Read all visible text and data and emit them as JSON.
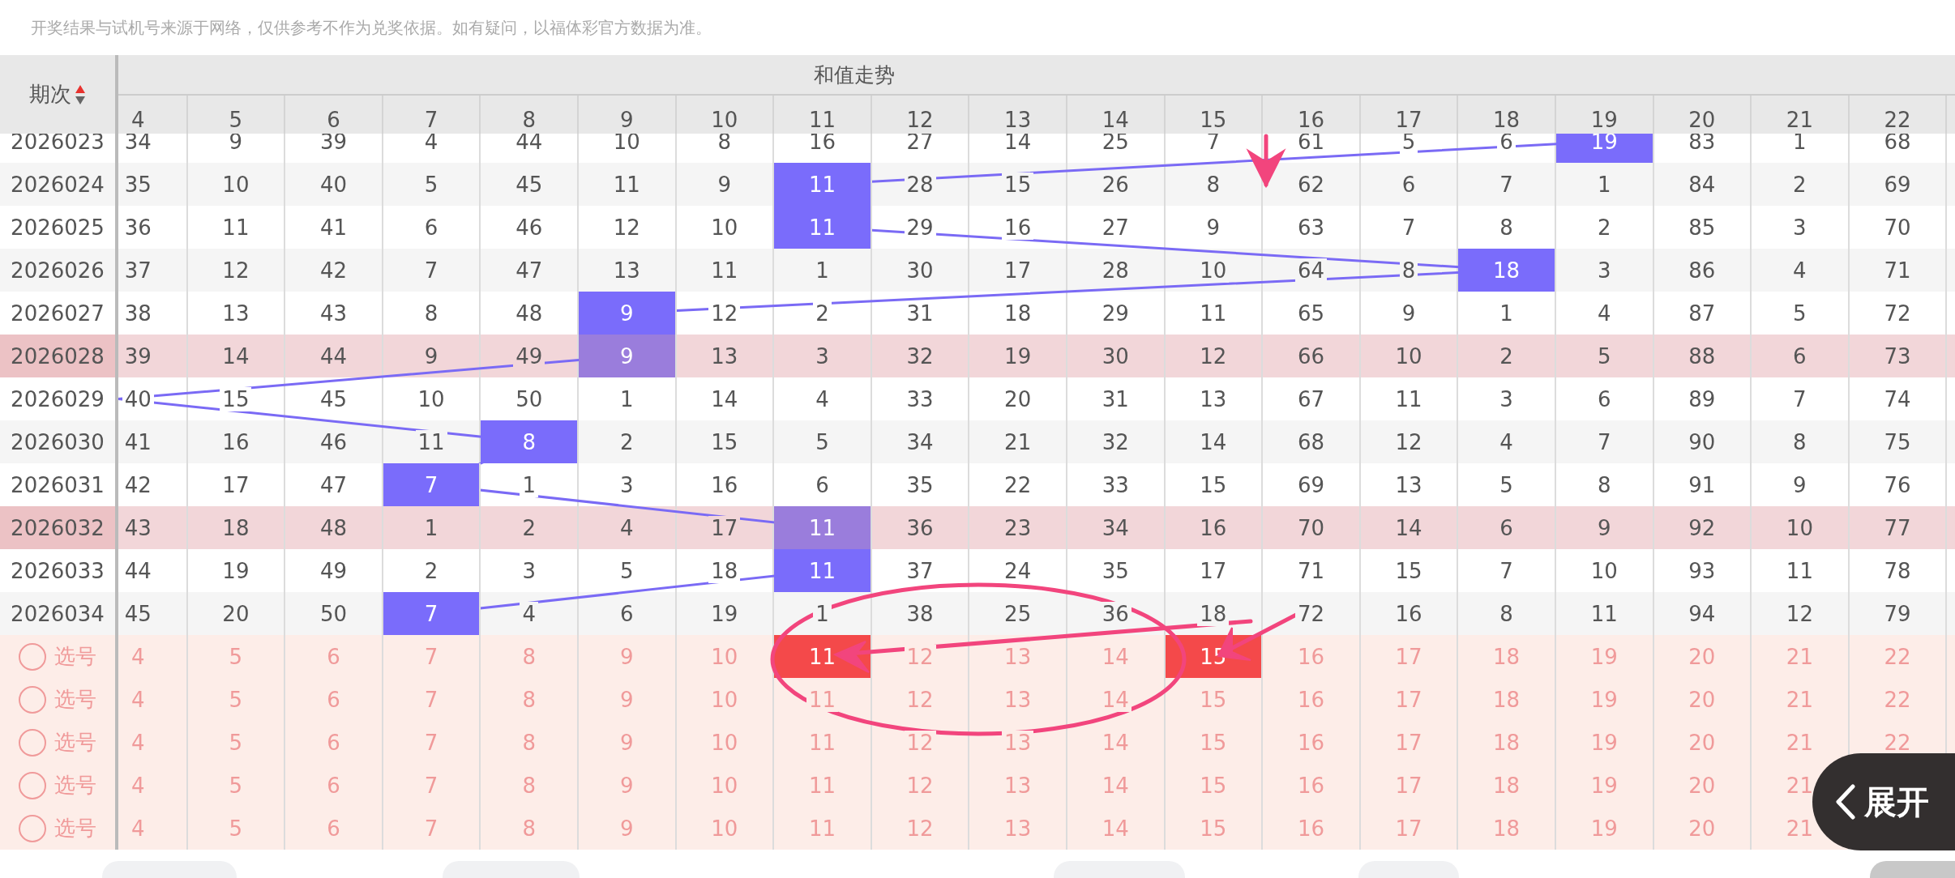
{
  "notice": "开奖结果与试机号来源于网络，仅供参考不作为兑奖依据。如有疑问，以福体彩官方数据为准。",
  "header": {
    "period_label": "期次",
    "title": "和值走势"
  },
  "columns": [
    "4",
    "5",
    "6",
    "7",
    "8",
    "9",
    "10",
    "11",
    "12",
    "13",
    "14",
    "15",
    "16",
    "17",
    "18",
    "19",
    "20",
    "21",
    "22"
  ],
  "rows": [
    {
      "period": "2026023",
      "highlighted": false,
      "cells": [
        {
          "text": "34",
          "hit": false
        },
        {
          "text": "9",
          "hit": false
        },
        {
          "text": "39",
          "hit": false
        },
        {
          "text": "4",
          "hit": false
        },
        {
          "text": "44",
          "hit": false
        },
        {
          "text": "10",
          "hit": false
        },
        {
          "text": "8",
          "hit": false
        },
        {
          "text": "16",
          "hit": false
        },
        {
          "text": "27",
          "hit": false
        },
        {
          "text": "14",
          "hit": false
        },
        {
          "text": "25",
          "hit": false
        },
        {
          "text": "7",
          "hit": false
        },
        {
          "text": "61",
          "hit": false
        },
        {
          "text": "5",
          "hit": false
        },
        {
          "text": "6",
          "hit": false
        },
        {
          "text": "19",
          "hit": true
        },
        {
          "text": "83",
          "hit": false
        },
        {
          "text": "1",
          "hit": false
        },
        {
          "text": "68",
          "hit": false
        }
      ]
    },
    {
      "period": "2026024",
      "highlighted": false,
      "cells": [
        {
          "text": "35",
          "hit": false
        },
        {
          "text": "10",
          "hit": false
        },
        {
          "text": "40",
          "hit": false
        },
        {
          "text": "5",
          "hit": false
        },
        {
          "text": "45",
          "hit": false
        },
        {
          "text": "11",
          "hit": false
        },
        {
          "text": "9",
          "hit": false
        },
        {
          "text": "11",
          "hit": true
        },
        {
          "text": "28",
          "hit": false
        },
        {
          "text": "15",
          "hit": false
        },
        {
          "text": "26",
          "hit": false
        },
        {
          "text": "8",
          "hit": false
        },
        {
          "text": "62",
          "hit": false
        },
        {
          "text": "6",
          "hit": false
        },
        {
          "text": "7",
          "hit": false
        },
        {
          "text": "1",
          "hit": false
        },
        {
          "text": "84",
          "hit": false
        },
        {
          "text": "2",
          "hit": false
        },
        {
          "text": "69",
          "hit": false
        }
      ]
    },
    {
      "period": "2026025",
      "highlighted": false,
      "cells": [
        {
          "text": "36",
          "hit": false
        },
        {
          "text": "11",
          "hit": false
        },
        {
          "text": "41",
          "hit": false
        },
        {
          "text": "6",
          "hit": false
        },
        {
          "text": "46",
          "hit": false
        },
        {
          "text": "12",
          "hit": false
        },
        {
          "text": "10",
          "hit": false
        },
        {
          "text": "11",
          "hit": true
        },
        {
          "text": "29",
          "hit": false
        },
        {
          "text": "16",
          "hit": false
        },
        {
          "text": "27",
          "hit": false
        },
        {
          "text": "9",
          "hit": false
        },
        {
          "text": "63",
          "hit": false
        },
        {
          "text": "7",
          "hit": false
        },
        {
          "text": "8",
          "hit": false
        },
        {
          "text": "2",
          "hit": false
        },
        {
          "text": "85",
          "hit": false
        },
        {
          "text": "3",
          "hit": false
        },
        {
          "text": "70",
          "hit": false
        }
      ]
    },
    {
      "period": "2026026",
      "highlighted": false,
      "cells": [
        {
          "text": "37",
          "hit": false
        },
        {
          "text": "12",
          "hit": false
        },
        {
          "text": "42",
          "hit": false
        },
        {
          "text": "7",
          "hit": false
        },
        {
          "text": "47",
          "hit": false
        },
        {
          "text": "13",
          "hit": false
        },
        {
          "text": "11",
          "hit": false
        },
        {
          "text": "1",
          "hit": false
        },
        {
          "text": "30",
          "hit": false
        },
        {
          "text": "17",
          "hit": false
        },
        {
          "text": "28",
          "hit": false
        },
        {
          "text": "10",
          "hit": false
        },
        {
          "text": "64",
          "hit": false
        },
        {
          "text": "8",
          "hit": false
        },
        {
          "text": "18",
          "hit": true
        },
        {
          "text": "3",
          "hit": false
        },
        {
          "text": "86",
          "hit": false
        },
        {
          "text": "4",
          "hit": false
        },
        {
          "text": "71",
          "hit": false
        }
      ]
    },
    {
      "period": "2026027",
      "highlighted": false,
      "cells": [
        {
          "text": "38",
          "hit": false
        },
        {
          "text": "13",
          "hit": false
        },
        {
          "text": "43",
          "hit": false
        },
        {
          "text": "8",
          "hit": false
        },
        {
          "text": "48",
          "hit": false
        },
        {
          "text": "9",
          "hit": true
        },
        {
          "text": "12",
          "hit": false
        },
        {
          "text": "2",
          "hit": false
        },
        {
          "text": "31",
          "hit": false
        },
        {
          "text": "18",
          "hit": false
        },
        {
          "text": "29",
          "hit": false
        },
        {
          "text": "11",
          "hit": false
        },
        {
          "text": "65",
          "hit": false
        },
        {
          "text": "9",
          "hit": false
        },
        {
          "text": "1",
          "hit": false
        },
        {
          "text": "4",
          "hit": false
        },
        {
          "text": "87",
          "hit": false
        },
        {
          "text": "5",
          "hit": false
        },
        {
          "text": "72",
          "hit": false
        }
      ]
    },
    {
      "period": "2026028",
      "highlighted": true,
      "cells": [
        {
          "text": "39",
          "hit": false
        },
        {
          "text": "14",
          "hit": false
        },
        {
          "text": "44",
          "hit": false
        },
        {
          "text": "9",
          "hit": false
        },
        {
          "text": "49",
          "hit": false
        },
        {
          "text": "9",
          "hit": true
        },
        {
          "text": "13",
          "hit": false
        },
        {
          "text": "3",
          "hit": false
        },
        {
          "text": "32",
          "hit": false
        },
        {
          "text": "19",
          "hit": false
        },
        {
          "text": "30",
          "hit": false
        },
        {
          "text": "12",
          "hit": false
        },
        {
          "text": "66",
          "hit": false
        },
        {
          "text": "10",
          "hit": false
        },
        {
          "text": "2",
          "hit": false
        },
        {
          "text": "5",
          "hit": false
        },
        {
          "text": "88",
          "hit": false
        },
        {
          "text": "6",
          "hit": false
        },
        {
          "text": "73",
          "hit": false
        }
      ]
    },
    {
      "period": "2026029",
      "highlighted": false,
      "cells": [
        {
          "text": "40",
          "hit": false
        },
        {
          "text": "15",
          "hit": false
        },
        {
          "text": "45",
          "hit": false
        },
        {
          "text": "10",
          "hit": false
        },
        {
          "text": "50",
          "hit": false
        },
        {
          "text": "1",
          "hit": false
        },
        {
          "text": "14",
          "hit": false
        },
        {
          "text": "4",
          "hit": false
        },
        {
          "text": "33",
          "hit": false
        },
        {
          "text": "20",
          "hit": false
        },
        {
          "text": "31",
          "hit": false
        },
        {
          "text": "13",
          "hit": false
        },
        {
          "text": "67",
          "hit": false
        },
        {
          "text": "11",
          "hit": false
        },
        {
          "text": "3",
          "hit": false
        },
        {
          "text": "6",
          "hit": false
        },
        {
          "text": "89",
          "hit": false
        },
        {
          "text": "7",
          "hit": false
        },
        {
          "text": "74",
          "hit": false
        }
      ]
    },
    {
      "period": "2026030",
      "highlighted": false,
      "cells": [
        {
          "text": "41",
          "hit": false
        },
        {
          "text": "16",
          "hit": false
        },
        {
          "text": "46",
          "hit": false
        },
        {
          "text": "11",
          "hit": false
        },
        {
          "text": "8",
          "hit": true
        },
        {
          "text": "2",
          "hit": false
        },
        {
          "text": "15",
          "hit": false
        },
        {
          "text": "5",
          "hit": false
        },
        {
          "text": "34",
          "hit": false
        },
        {
          "text": "21",
          "hit": false
        },
        {
          "text": "32",
          "hit": false
        },
        {
          "text": "14",
          "hit": false
        },
        {
          "text": "68",
          "hit": false
        },
        {
          "text": "12",
          "hit": false
        },
        {
          "text": "4",
          "hit": false
        },
        {
          "text": "7",
          "hit": false
        },
        {
          "text": "90",
          "hit": false
        },
        {
          "text": "8",
          "hit": false
        },
        {
          "text": "75",
          "hit": false
        }
      ]
    },
    {
      "period": "2026031",
      "highlighted": false,
      "cells": [
        {
          "text": "42",
          "hit": false
        },
        {
          "text": "17",
          "hit": false
        },
        {
          "text": "47",
          "hit": false
        },
        {
          "text": "7",
          "hit": true
        },
        {
          "text": "1",
          "hit": false
        },
        {
          "text": "3",
          "hit": false
        },
        {
          "text": "16",
          "hit": false
        },
        {
          "text": "6",
          "hit": false
        },
        {
          "text": "35",
          "hit": false
        },
        {
          "text": "22",
          "hit": false
        },
        {
          "text": "33",
          "hit": false
        },
        {
          "text": "15",
          "hit": false
        },
        {
          "text": "69",
          "hit": false
        },
        {
          "text": "13",
          "hit": false
        },
        {
          "text": "5",
          "hit": false
        },
        {
          "text": "8",
          "hit": false
        },
        {
          "text": "91",
          "hit": false
        },
        {
          "text": "9",
          "hit": false
        },
        {
          "text": "76",
          "hit": false
        }
      ]
    },
    {
      "period": "2026032",
      "highlighted": true,
      "cells": [
        {
          "text": "43",
          "hit": false
        },
        {
          "text": "18",
          "hit": false
        },
        {
          "text": "48",
          "hit": false
        },
        {
          "text": "1",
          "hit": false
        },
        {
          "text": "2",
          "hit": false
        },
        {
          "text": "4",
          "hit": false
        },
        {
          "text": "17",
          "hit": false
        },
        {
          "text": "11",
          "hit": true
        },
        {
          "text": "36",
          "hit": false
        },
        {
          "text": "23",
          "hit": false
        },
        {
          "text": "34",
          "hit": false
        },
        {
          "text": "16",
          "hit": false
        },
        {
          "text": "70",
          "hit": false
        },
        {
          "text": "14",
          "hit": false
        },
        {
          "text": "6",
          "hit": false
        },
        {
          "text": "9",
          "hit": false
        },
        {
          "text": "92",
          "hit": false
        },
        {
          "text": "10",
          "hit": false
        },
        {
          "text": "77",
          "hit": false
        }
      ]
    },
    {
      "period": "2026033",
      "highlighted": false,
      "cells": [
        {
          "text": "44",
          "hit": false
        },
        {
          "text": "19",
          "hit": false
        },
        {
          "text": "49",
          "hit": false
        },
        {
          "text": "2",
          "hit": false
        },
        {
          "text": "3",
          "hit": false
        },
        {
          "text": "5",
          "hit": false
        },
        {
          "text": "18",
          "hit": false
        },
        {
          "text": "11",
          "hit": true
        },
        {
          "text": "37",
          "hit": false
        },
        {
          "text": "24",
          "hit": false
        },
        {
          "text": "35",
          "hit": false
        },
        {
          "text": "17",
          "hit": false
        },
        {
          "text": "71",
          "hit": false
        },
        {
          "text": "15",
          "hit": false
        },
        {
          "text": "7",
          "hit": false
        },
        {
          "text": "10",
          "hit": false
        },
        {
          "text": "93",
          "hit": false
        },
        {
          "text": "11",
          "hit": false
        },
        {
          "text": "78",
          "hit": false
        }
      ]
    },
    {
      "period": "2026034",
      "highlighted": false,
      "cells": [
        {
          "text": "45",
          "hit": false
        },
        {
          "text": "20",
          "hit": false
        },
        {
          "text": "50",
          "hit": false
        },
        {
          "text": "7",
          "hit": true
        },
        {
          "text": "4",
          "hit": false
        },
        {
          "text": "6",
          "hit": false
        },
        {
          "text": "19",
          "hit": false
        },
        {
          "text": "1",
          "hit": false
        },
        {
          "text": "38",
          "hit": false
        },
        {
          "text": "25",
          "hit": false
        },
        {
          "text": "36",
          "hit": false
        },
        {
          "text": "18",
          "hit": false
        },
        {
          "text": "72",
          "hit": false
        },
        {
          "text": "16",
          "hit": false
        },
        {
          "text": "8",
          "hit": false
        },
        {
          "text": "11",
          "hit": false
        },
        {
          "text": "94",
          "hit": false
        },
        {
          "text": "12",
          "hit": false
        },
        {
          "text": "79",
          "hit": false
        }
      ]
    }
  ],
  "picks": [
    {
      "label": "选号",
      "cells": [
        {
          "text": "4",
          "selected": false
        },
        {
          "text": "5",
          "selected": false
        },
        {
          "text": "6",
          "selected": false
        },
        {
          "text": "7",
          "selected": false
        },
        {
          "text": "8",
          "selected": false
        },
        {
          "text": "9",
          "selected": false
        },
        {
          "text": "10",
          "selected": false
        },
        {
          "text": "11",
          "selected": true
        },
        {
          "text": "12",
          "selected": false
        },
        {
          "text": "13",
          "selected": false
        },
        {
          "text": "14",
          "selected": false
        },
        {
          "text": "15",
          "selected": true
        },
        {
          "text": "16",
          "selected": false
        },
        {
          "text": "17",
          "selected": false
        },
        {
          "text": "18",
          "selected": false
        },
        {
          "text": "19",
          "selected": false
        },
        {
          "text": "20",
          "selected": false
        },
        {
          "text": "21",
          "selected": false
        },
        {
          "text": "22",
          "selected": false
        }
      ]
    },
    {
      "label": "选号",
      "cells": [
        {
          "text": "4",
          "selected": false
        },
        {
          "text": "5",
          "selected": false
        },
        {
          "text": "6",
          "selected": false
        },
        {
          "text": "7",
          "selected": false
        },
        {
          "text": "8",
          "selected": false
        },
        {
          "text": "9",
          "selected": false
        },
        {
          "text": "10",
          "selected": false
        },
        {
          "text": "11",
          "selected": false
        },
        {
          "text": "12",
          "selected": false
        },
        {
          "text": "13",
          "selected": false
        },
        {
          "text": "14",
          "selected": false
        },
        {
          "text": "15",
          "selected": false
        },
        {
          "text": "16",
          "selected": false
        },
        {
          "text": "17",
          "selected": false
        },
        {
          "text": "18",
          "selected": false
        },
        {
          "text": "19",
          "selected": false
        },
        {
          "text": "20",
          "selected": false
        },
        {
          "text": "21",
          "selected": false
        },
        {
          "text": "22",
          "selected": false
        }
      ]
    },
    {
      "label": "选号",
      "cells": [
        {
          "text": "4",
          "selected": false
        },
        {
          "text": "5",
          "selected": false
        },
        {
          "text": "6",
          "selected": false
        },
        {
          "text": "7",
          "selected": false
        },
        {
          "text": "8",
          "selected": false
        },
        {
          "text": "9",
          "selected": false
        },
        {
          "text": "10",
          "selected": false
        },
        {
          "text": "11",
          "selected": false
        },
        {
          "text": "12",
          "selected": false
        },
        {
          "text": "13",
          "selected": false
        },
        {
          "text": "14",
          "selected": false
        },
        {
          "text": "15",
          "selected": false
        },
        {
          "text": "16",
          "selected": false
        },
        {
          "text": "17",
          "selected": false
        },
        {
          "text": "18",
          "selected": false
        },
        {
          "text": "19",
          "selected": false
        },
        {
          "text": "20",
          "selected": false
        },
        {
          "text": "21",
          "selected": false
        },
        {
          "text": "22",
          "selected": false
        }
      ]
    },
    {
      "label": "选号",
      "cells": [
        {
          "text": "4",
          "selected": false
        },
        {
          "text": "5",
          "selected": false
        },
        {
          "text": "6",
          "selected": false
        },
        {
          "text": "7",
          "selected": false
        },
        {
          "text": "8",
          "selected": false
        },
        {
          "text": "9",
          "selected": false
        },
        {
          "text": "10",
          "selected": false
        },
        {
          "text": "11",
          "selected": false
        },
        {
          "text": "12",
          "selected": false
        },
        {
          "text": "13",
          "selected": false
        },
        {
          "text": "14",
          "selected": false
        },
        {
          "text": "15",
          "selected": false
        },
        {
          "text": "16",
          "selected": false
        },
        {
          "text": "17",
          "selected": false
        },
        {
          "text": "18",
          "selected": false
        },
        {
          "text": "19",
          "selected": false
        },
        {
          "text": "20",
          "selected": false
        },
        {
          "text": "21",
          "selected": false
        }
      ]
    },
    {
      "label": "选号",
      "cells": [
        {
          "text": "4",
          "selected": false
        },
        {
          "text": "5",
          "selected": false
        },
        {
          "text": "6",
          "selected": false
        },
        {
          "text": "7",
          "selected": false
        },
        {
          "text": "8",
          "selected": false
        },
        {
          "text": "9",
          "selected": false
        },
        {
          "text": "10",
          "selected": false
        },
        {
          "text": "11",
          "selected": false
        },
        {
          "text": "12",
          "selected": false
        },
        {
          "text": "13",
          "selected": false
        },
        {
          "text": "14",
          "selected": false
        },
        {
          "text": "15",
          "selected": false
        },
        {
          "text": "16",
          "selected": false
        },
        {
          "text": "17",
          "selected": false
        },
        {
          "text": "18",
          "selected": false
        },
        {
          "text": "19",
          "selected": false
        },
        {
          "text": "20",
          "selected": false
        },
        {
          "text": "21",
          "selected": false
        }
      ]
    }
  ],
  "expand_button": "展开"
}
